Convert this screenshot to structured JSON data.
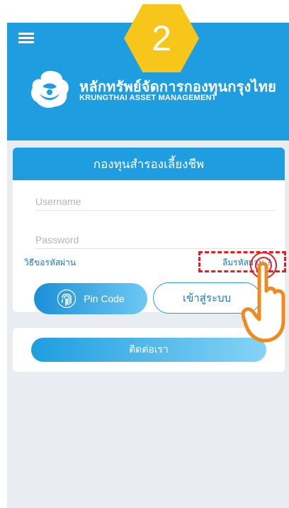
{
  "step_number": "2",
  "header": {
    "brand_th": "หลักทรัพย์จัดการกองทุนกรุงไทย",
    "brand_en": "KRUNGTHAI ASSET MANAGEMENT"
  },
  "login": {
    "title": "กองทุนสำรองเลี้ยงชีพ",
    "username_placeholder": "Username",
    "password_placeholder": "Password",
    "how_to_request_password": "วิธีขอรหัสผ่าน",
    "forgot_password": "ลืมรหัสผ่าน ?",
    "pin_code_label": "Pin Code",
    "login_label": "เข้าสู่ระบบ"
  },
  "contact": {
    "label": "ติดต่อเรา"
  },
  "colors": {
    "header_blue": "#1e9ee0",
    "badge_yellow": "#f8c51b",
    "highlight_red": "#e51e25",
    "hand_orange": "#f08a1f"
  },
  "icons": [
    "menu-icon",
    "logo",
    "fingerprint-icon",
    "pointing-hand-icon"
  ]
}
